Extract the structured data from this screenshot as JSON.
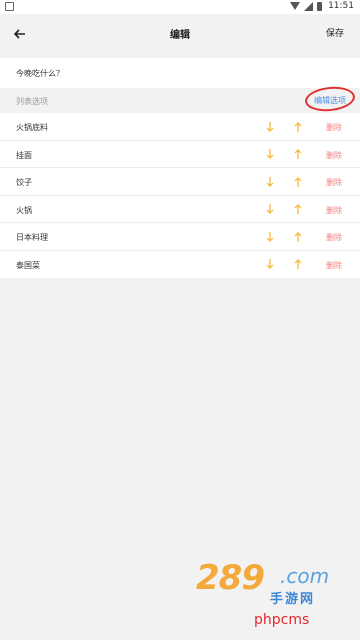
{
  "status_bar": {
    "time": "11:51"
  },
  "app_bar": {
    "title": "编辑",
    "save_label": "保存"
  },
  "question": "今晚吃什么？",
  "list_header": {
    "label": "列表选项",
    "edit_link": "编辑选项"
  },
  "items": [
    {
      "name": "火锅底料",
      "delete_label": "删除"
    },
    {
      "name": "挂面",
      "delete_label": "删除"
    },
    {
      "name": "饺子",
      "delete_label": "删除"
    },
    {
      "name": "火锅",
      "delete_label": "删除"
    },
    {
      "name": "日本料理",
      "delete_label": "删除"
    },
    {
      "name": "泰国菜",
      "delete_label": "删除"
    }
  ],
  "watermark": {
    "number": "289",
    "suffix": ".com",
    "cn": "手游网"
  },
  "footer_logo": "phpcms",
  "colors": {
    "arrow": "#f5b52e",
    "delete": "#f08080",
    "link": "#4a8fe7",
    "circle": "#e03030"
  },
  "icons": {
    "back": "arrow-left-icon",
    "down": "arrow-down-icon",
    "up": "arrow-up-icon"
  }
}
